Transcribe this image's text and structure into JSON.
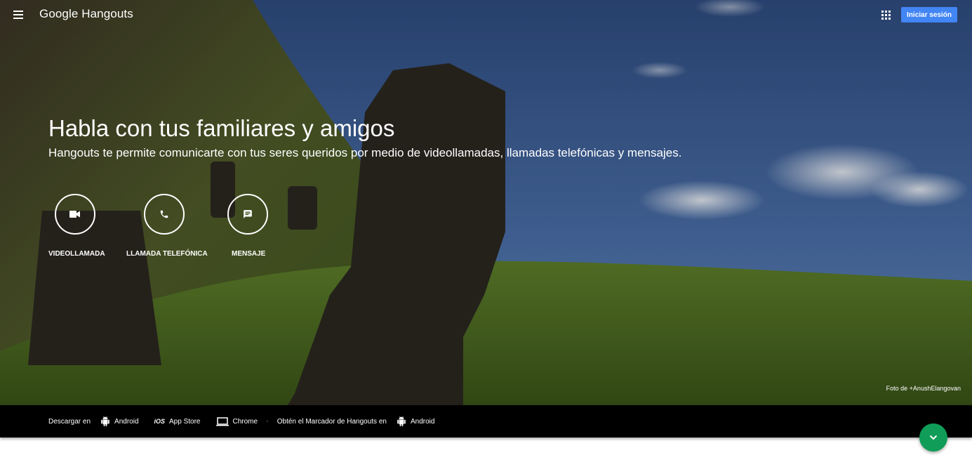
{
  "header": {
    "logo_text": "Google Hangouts",
    "signin_label": "Iniciar sesión",
    "menu_icon": "hamburger-menu-icon",
    "apps_icon": "apps-grid-icon"
  },
  "hero": {
    "title": "Habla con tus familiares y amigos",
    "subtitle": "Hangouts te permite comunicarte con tus seres queridos por medio de videollamadas, llamadas telefónicas y mensajes.",
    "actions": [
      {
        "label": "VIDEOLLAMADA",
        "icon": "videocam-icon"
      },
      {
        "label": "LLAMADA TELEFÓNICA",
        "icon": "phone-icon"
      },
      {
        "label": "MENSAJE",
        "icon": "message-icon"
      }
    ],
    "photo_credit": "Foto de +AnushElangovan"
  },
  "footer": {
    "download_label": "Descargar en",
    "links": [
      {
        "label": "Android",
        "icon": "android-icon"
      },
      {
        "label": "App Store",
        "icon": "ios-icon",
        "icon_text": "iOS"
      },
      {
        "label": "Chrome",
        "icon": "laptop-icon"
      }
    ],
    "separator": "·",
    "dialer_label": "Obtén el Marcador de Hangouts en",
    "dialer_link": {
      "label": "Android",
      "icon": "android-icon"
    }
  },
  "fab": {
    "icon": "chevron-down-icon"
  },
  "colors": {
    "primary_button": "#4285f4",
    "fab": "#0f9d58",
    "footer_bg": "#000000",
    "sky": "#3d5f95",
    "grass": "#4c6b22"
  }
}
